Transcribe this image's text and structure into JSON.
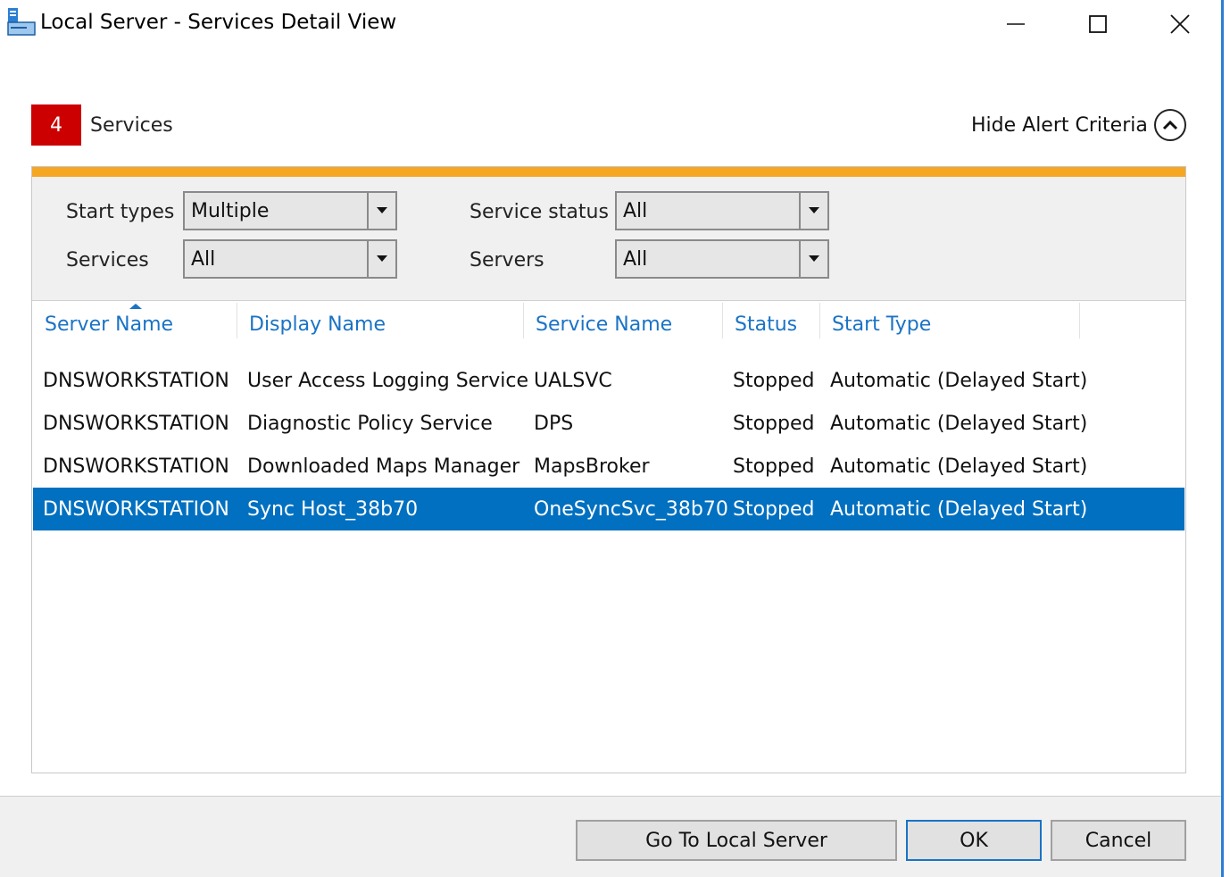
{
  "window": {
    "title": "Local Server - Services Detail View",
    "accent_color": "#0270c0",
    "controls": {
      "minimize": "minimize-icon",
      "maximize": "maximize-icon",
      "close": "close-icon"
    }
  },
  "header": {
    "count": "4",
    "count_label": "Services",
    "badge_color": "#cc0000",
    "hide_criteria_label": "Hide Alert Criteria"
  },
  "filters": {
    "start_types": {
      "label": "Start types",
      "value": "Multiple"
    },
    "services": {
      "label": "Services",
      "value": "All"
    },
    "service_status": {
      "label": "Service status",
      "value": "All"
    },
    "servers": {
      "label": "Servers",
      "value": "All"
    }
  },
  "table": {
    "columns": [
      "Server Name",
      "Display Name",
      "Service Name",
      "Status",
      "Start Type"
    ],
    "sorted_column": "Server Name",
    "rows": [
      [
        "DNSWORKSTATION",
        "User Access Logging Service",
        "UALSVC",
        "Stopped",
        "Automatic (Delayed Start)"
      ],
      [
        "DNSWORKSTATION",
        "Diagnostic Policy Service",
        "DPS",
        "Stopped",
        "Automatic (Delayed Start)"
      ],
      [
        "DNSWORKSTATION",
        "Downloaded Maps Manager",
        "MapsBroker",
        "Stopped",
        "Automatic (Delayed Start)"
      ],
      [
        "DNSWORKSTATION",
        "Sync Host_38b70",
        "OneSyncSvc_38b70",
        "Stopped",
        "Automatic (Delayed Start)"
      ]
    ],
    "selected_row": 3
  },
  "footer": {
    "go_to_label": "Go To Local Server",
    "ok_label": "OK",
    "cancel_label": "Cancel"
  }
}
